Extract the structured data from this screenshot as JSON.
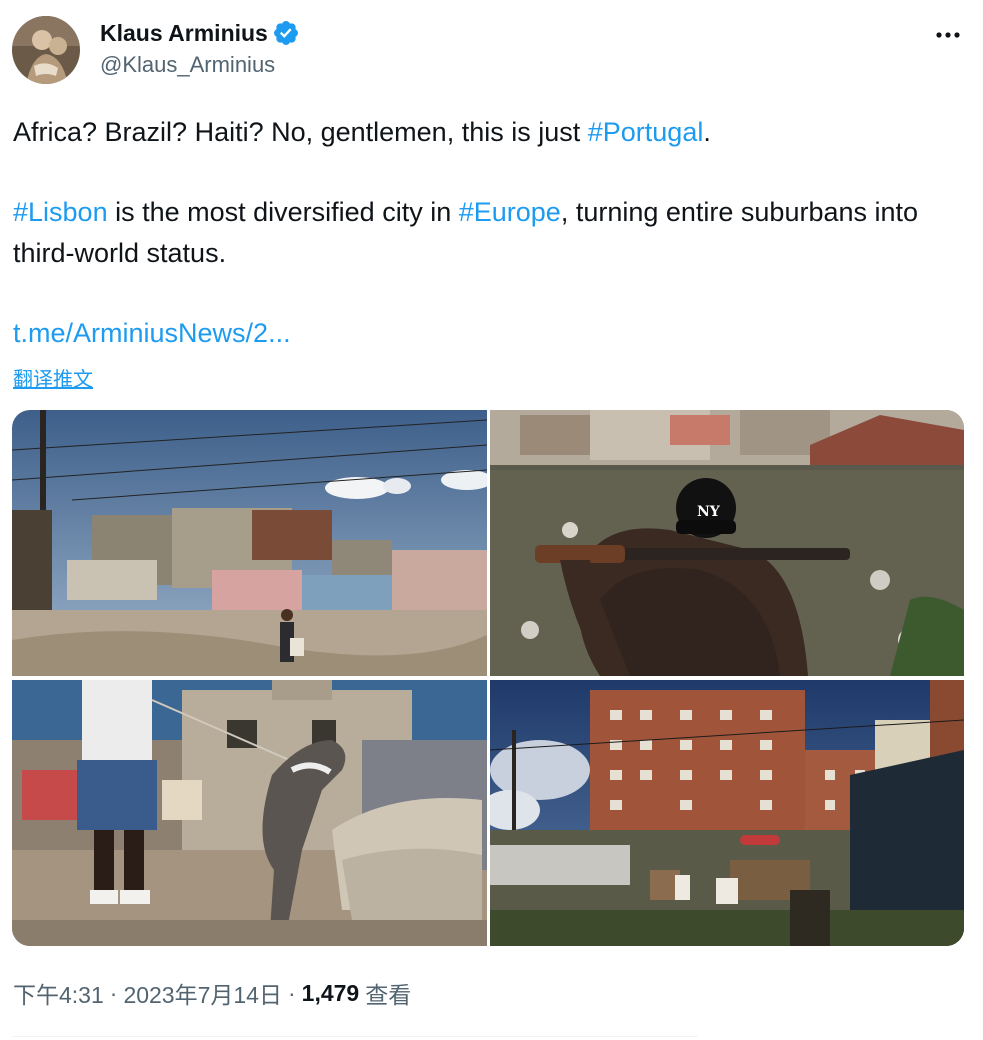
{
  "author": {
    "display_name": "Klaus Arminius",
    "handle": "@Klaus_Arminius",
    "verified": true,
    "verified_color": "#1d9bf0"
  },
  "more_menu": {
    "icon": "more-horizontal-icon"
  },
  "tweet": {
    "line1_prefix": "Africa? Brazil? Haiti? No, gentlemen, this is just ",
    "line1_tag": "#Portugal",
    "line1_suffix": ".",
    "line2_tag1": "#Lisbon",
    "line2_mid": " is the most diversified city in ",
    "line2_tag2": "#Europe",
    "line2_suffix": ", turning entire suburbans into third-world status.",
    "link": "t.me/ArminiusNews/2..."
  },
  "translate_label": "翻译推文",
  "meta": {
    "time": "下午4:31",
    "separator": "·",
    "date": "2023年7月14日",
    "views_count": "1,479",
    "views_label": "查看"
  },
  "colors": {
    "accent": "#1d9bf0",
    "text": "#0f1419",
    "secondary": "#536471"
  }
}
